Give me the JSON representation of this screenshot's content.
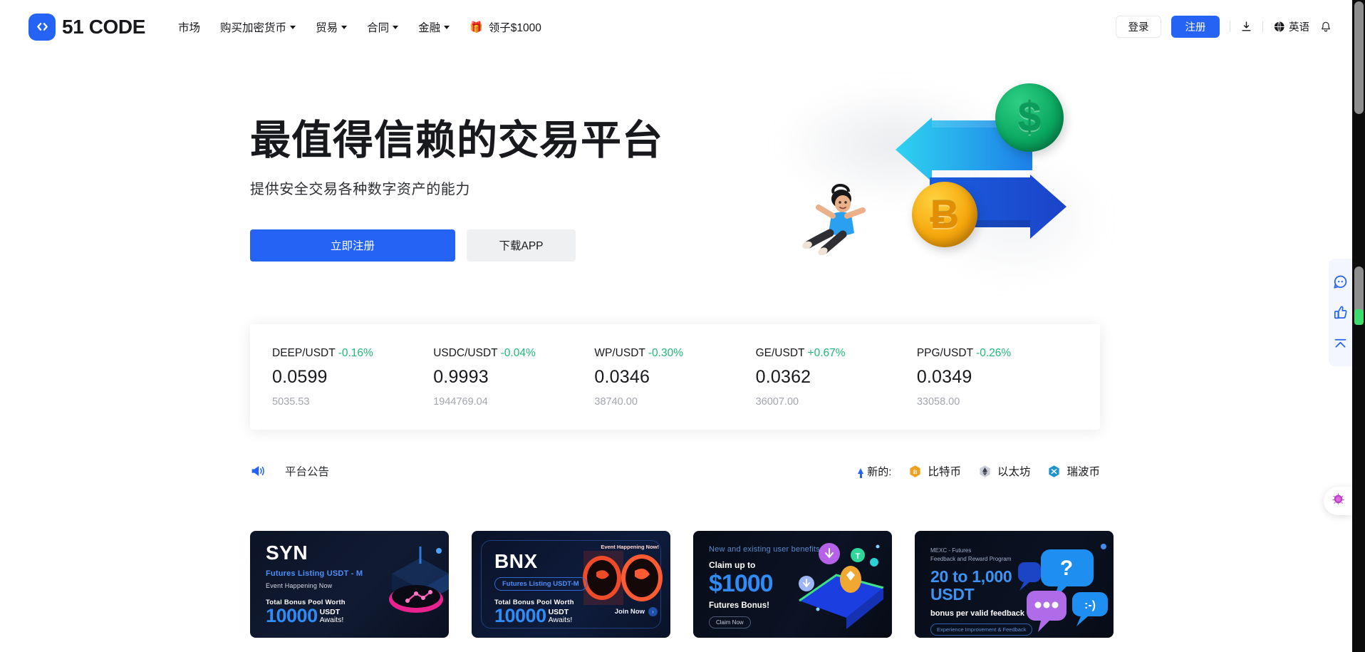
{
  "brand": {
    "name": "51 CODE",
    "logo_icon": "code-brackets-icon",
    "accent": "#2563f5"
  },
  "nav": {
    "items": [
      {
        "label": "市场",
        "has_dropdown": false
      },
      {
        "label": "购买加密货币",
        "has_dropdown": true
      },
      {
        "label": "贸易",
        "has_dropdown": true
      },
      {
        "label": "合同",
        "has_dropdown": true
      },
      {
        "label": "金融",
        "has_dropdown": true
      },
      {
        "label": "领子$1000",
        "has_dropdown": false,
        "icon": "gift-icon"
      }
    ]
  },
  "header_actions": {
    "login_label": "登录",
    "signup_label": "注册",
    "download_icon": "download-icon",
    "language_label": "英语",
    "language_icon": "globe-icon",
    "notification_icon": "bell-icon"
  },
  "hero": {
    "title": "最值得信赖的交易平台",
    "subtitle": "提供安全交易各种数字资产的能力",
    "primary_cta": "立即注册",
    "secondary_cta": "下载APP",
    "illustration": {
      "dollar_coin_symbol": "$",
      "bitcoin_coin_symbol": "Ƀ",
      "arrows": [
        "exchange-arrow-left-icon",
        "exchange-arrow-right-icon"
      ],
      "character": "flying-person-icon"
    }
  },
  "tickers": [
    {
      "pair": "DEEP/USDT",
      "change": "-0.16%",
      "price": "0.0599",
      "volume": "5035.53",
      "change_color": "#1fb87a"
    },
    {
      "pair": "USDC/USDT",
      "change": "-0.04%",
      "price": "0.9993",
      "volume": "1944769.04",
      "change_color": "#1fb87a"
    },
    {
      "pair": "WP/USDT",
      "change": "-0.30%",
      "price": "0.0346",
      "volume": "38740.00",
      "change_color": "#1fb87a"
    },
    {
      "pair": "GE/USDT",
      "change": "+0.67%",
      "price": "0.0362",
      "volume": "36007.00",
      "change_color": "#1fb87a"
    },
    {
      "pair": "PPG/USDT",
      "change": "-0.26%",
      "price": "0.0349",
      "volume": "33058.00",
      "change_color": "#1fb87a"
    }
  ],
  "announcement": {
    "megaphone_icon": "megaphone-icon",
    "label": "平台公告",
    "new_label": "新的:",
    "new_arrow_icon": "arrow-up-icon",
    "coins": [
      {
        "name": "比特币",
        "icon": "bitcoin-icon",
        "color": "#f0a020"
      },
      {
        "name": "以太坊",
        "icon": "ethereum-icon",
        "color": "#b8bfd6"
      },
      {
        "name": "瑞波币",
        "icon": "ripple-icon",
        "color": "#1d93d2"
      }
    ]
  },
  "promos": [
    {
      "id": "syn",
      "title": "SYN",
      "line1": "Futures Listing USDT - M",
      "line2": "Event Happening Now",
      "pool_label": "Total Bonus Pool Worth",
      "amount": "10000",
      "amount_unit": "USDT",
      "amount_suffix": "Awaits!"
    },
    {
      "id": "bnx",
      "title": "BNX",
      "pill": "Futures Listing USDT-M",
      "badge": "Event Happening Now!",
      "pool_label": "Total Bonus Pool Worth",
      "amount": "10000",
      "amount_unit": "USDT",
      "amount_suffix": "Awaits!",
      "cta": "Join Now"
    },
    {
      "id": "claim1000",
      "eyebrow": "New and existing user benefits",
      "line1": "Claim up to",
      "amount": "$1000",
      "line2": "Futures Bonus!",
      "cta": "Claim Now"
    },
    {
      "id": "feedback",
      "eyebrow_line1": "MEXC - Futures",
      "eyebrow_line2": "Feedback and Reward Program",
      "amount_line1": "20 to 1,000",
      "amount_line2": "USDT",
      "line2": "bonus per valid feedback",
      "pill": "Experience Improvement & Feedback"
    }
  ],
  "rail": {
    "items": [
      {
        "icon": "chat-bubble-icon",
        "name": "customer-service"
      },
      {
        "icon": "thumbs-up-icon",
        "name": "feedback"
      },
      {
        "icon": "scroll-to-top-icon",
        "name": "back-to-top"
      }
    ],
    "pin_icon": "location-pin-icon"
  }
}
